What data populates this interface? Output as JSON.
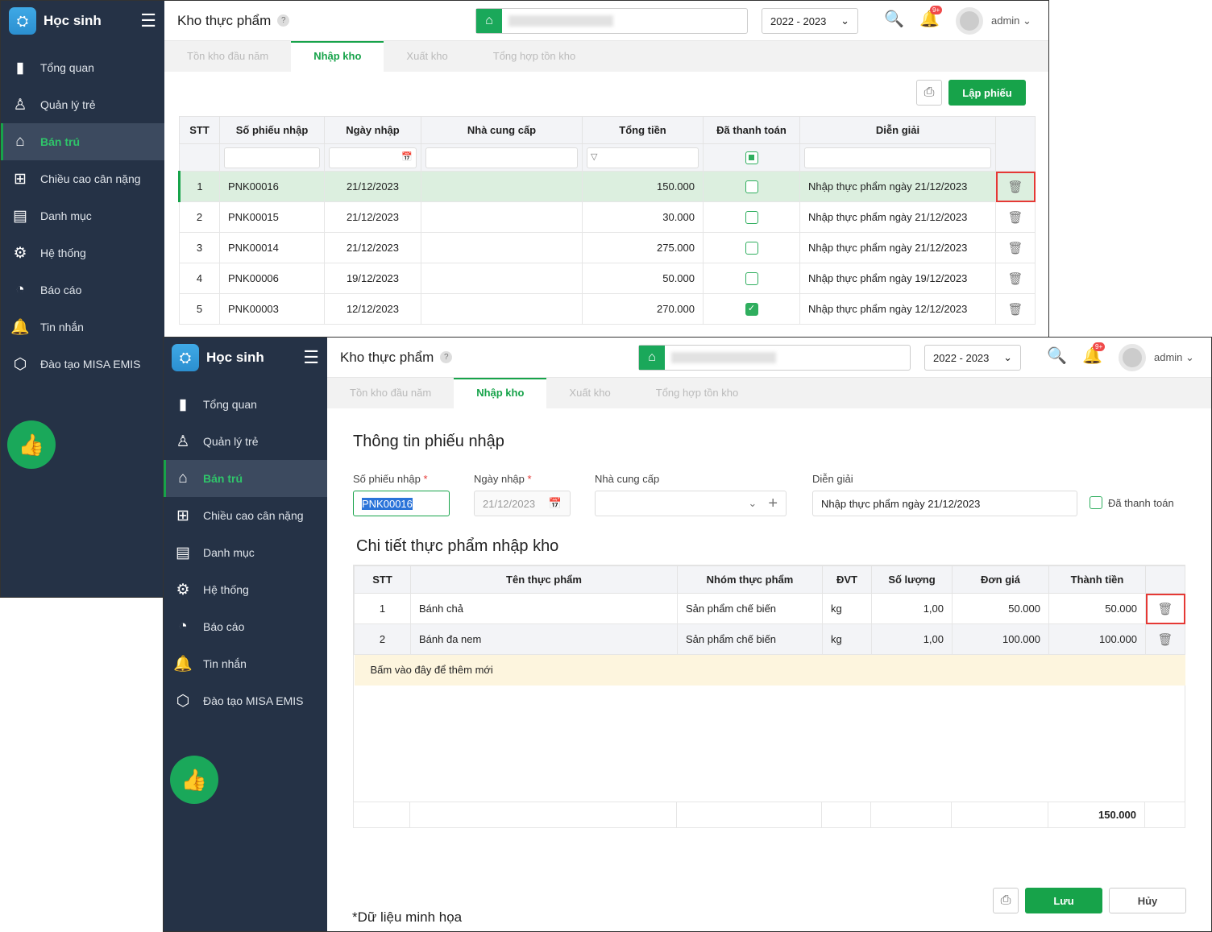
{
  "sidebar": {
    "brand": "Học sinh",
    "items": [
      {
        "label": "Tổng quan",
        "icon": "chart-bars-icon"
      },
      {
        "label": "Quản lý trẻ",
        "icon": "child-icon"
      },
      {
        "label": "Bán trú",
        "icon": "house-icon"
      },
      {
        "label": "Chiều cao cân nặng",
        "icon": "clipboard-plus-icon"
      },
      {
        "label": "Danh mục",
        "icon": "folder-icon"
      },
      {
        "label": "Hệ thống",
        "icon": "gear-icon"
      },
      {
        "label": "Báo cáo",
        "icon": "pie-chart-icon"
      },
      {
        "label": "Tin nhắn",
        "icon": "bell-icon"
      },
      {
        "label": "Đào tạo MISA EMIS",
        "icon": "cube-icon"
      }
    ]
  },
  "header": {
    "title": "Kho thực phẩm",
    "help": "?",
    "year": "2022 - 2023",
    "badge": "9+",
    "user": "admin"
  },
  "tabs": [
    "Tồn kho đầu năm",
    "Nhập kho",
    "Xuất kho",
    "Tổng hợp tồn kho"
  ],
  "list": {
    "print_label": "⎙",
    "create_label": "Lập phiếu",
    "columns": [
      "STT",
      "Số phiếu nhập",
      "Ngày nhập",
      "Nhà cung cấp",
      "Tổng tiền",
      "Đã thanh toán",
      "Diễn giải"
    ],
    "rows": [
      {
        "stt": "1",
        "code": "PNK00016",
        "date": "21/12/2023",
        "supplier": "",
        "total": "150.000",
        "paid": false,
        "desc": "Nhập thực phẩm ngày 21/12/2023"
      },
      {
        "stt": "2",
        "code": "PNK00015",
        "date": "21/12/2023",
        "supplier": "",
        "total": "30.000",
        "paid": false,
        "desc": "Nhập thực phẩm ngày 21/12/2023"
      },
      {
        "stt": "3",
        "code": "PNK00014",
        "date": "21/12/2023",
        "supplier": "",
        "total": "275.000",
        "paid": false,
        "desc": "Nhập thực phẩm ngày 21/12/2023"
      },
      {
        "stt": "4",
        "code": "PNK00006",
        "date": "19/12/2023",
        "supplier": "",
        "total": "50.000",
        "paid": false,
        "desc": "Nhập thực phẩm ngày 19/12/2023"
      },
      {
        "stt": "5",
        "code": "PNK00003",
        "date": "12/12/2023",
        "supplier": "",
        "total": "270.000",
        "paid": true,
        "desc": "Nhập thực phẩm ngày 12/12/2023"
      }
    ]
  },
  "form": {
    "section1": "Thông tin phiếu nhập",
    "code_label": "Số phiếu nhập",
    "code_value": "PNK00016",
    "date_label": "Ngày nhập",
    "date_value": "21/12/2023",
    "supplier_label": "Nhà cung cấp",
    "supplier_value": "",
    "desc_label": "Diễn giải",
    "desc_value": "Nhập thực phẩm ngày 21/12/2023",
    "paid_label": "Đã thanh toán",
    "required": "*",
    "section2": "Chi tiết thực phẩm nhập kho",
    "columns": [
      "STT",
      "Tên thực phẩm",
      "Nhóm thực phẩm",
      "ĐVT",
      "Số lượng",
      "Đơn giá",
      "Thành tiền"
    ],
    "rows": [
      {
        "stt": "1",
        "name": "Bánh chả",
        "group": "Sản phẩm chế biến",
        "unit": "kg",
        "qty": "1,00",
        "price": "50.000",
        "amount": "50.000"
      },
      {
        "stt": "2",
        "name": "Bánh đa nem",
        "group": "Sản phẩm chế biến",
        "unit": "kg",
        "qty": "1,00",
        "price": "100.000",
        "amount": "100.000"
      }
    ],
    "add_new": "Bấm vào đây để thêm mới",
    "grand_total": "150.000",
    "save": "Lưu",
    "cancel": "Hủy",
    "note": "*Dữ liệu minh họa"
  }
}
